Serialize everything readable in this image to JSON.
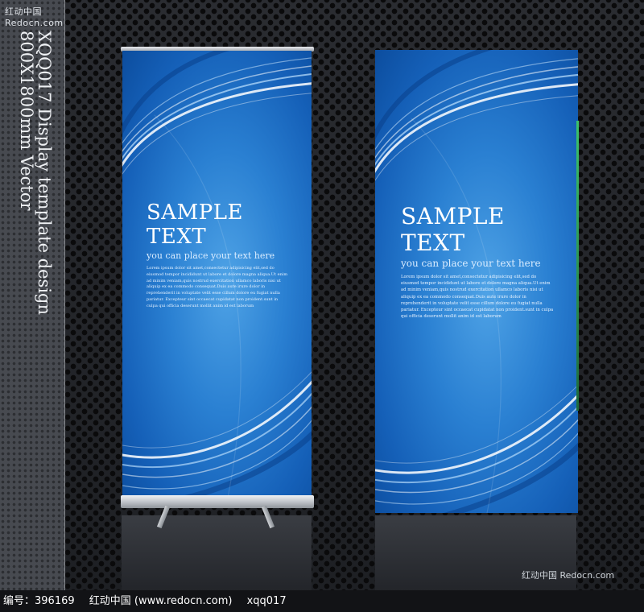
{
  "site": {
    "top_watermark": "红动中国 Redocn.com",
    "corner_watermark": "红动中国 Redocn.com"
  },
  "caption": {
    "line1": "XQQ017 Display template design",
    "line2": "800X1800mm Vector"
  },
  "banners": [
    {
      "title": "SAMPLE TEXT",
      "subtitle": "you can place your text here",
      "body": "Lorem ipsum dolor sit amet,consectetur adipisicing elit,sed do eiusmod tempor incididunt ut labore et dolore magna aliqua.Ut enim ad minim veniam,quis nostrud exercitation ullamco laboris nisi ut aliquip ex ea commodo consequat.Duis aute irure dolor in reprehenderit in voluptate velit esse cillum dolore eu fugiat nulla pariatur. Excepteur sint occaecat cupidatat non proident.sunt in culpa qui officia deserunt mollit anim id est laborum"
    },
    {
      "title": "SAMPLE TEXT",
      "subtitle": "you can place your text here",
      "body": "Lorem ipsum dolor sit amet,consectetur adipisicing elit,sed do eiusmod tempor incididunt ut labore et dolore magna aliqua.Ut enim ad minim veniam,quis nostrud exercitation ullamco laboris nisi ut aliquip ex ea commodo consequat.Duis aute irure dolor in reprehenderit in voluptate velit esse cillum dolore eu fugiat nulla pariatur. Excepteur sint occaecat cupidatat non proident.sunt in culpa qui officia deserunt mollit anim id est laborum"
    }
  ],
  "footer": {
    "id_label": "编号：396169",
    "site_label": "红动中国 (www.redocn.com)",
    "code": "xqq017"
  },
  "colors": {
    "banner_blue": "#2a80d2",
    "background_dark": "#202226"
  }
}
